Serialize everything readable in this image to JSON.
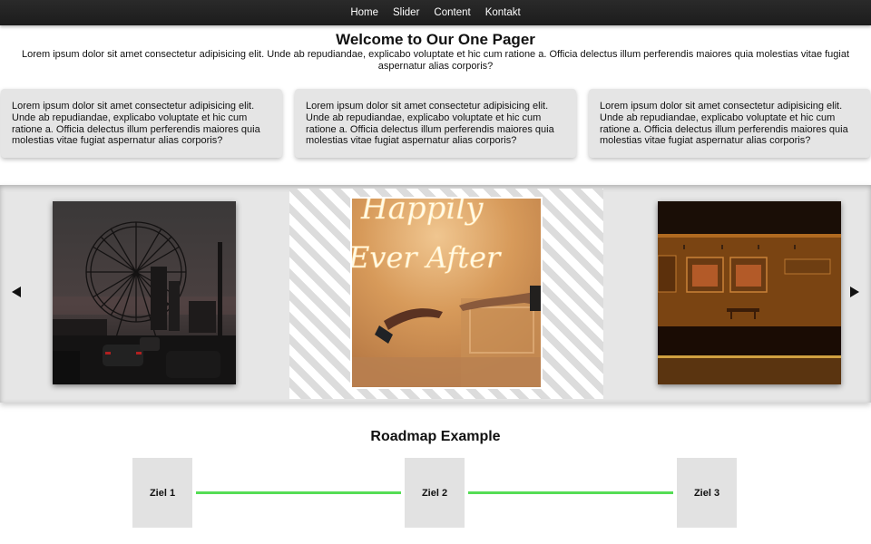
{
  "nav": {
    "items": [
      "Home",
      "Slider",
      "Content",
      "Kontakt"
    ]
  },
  "hero": {
    "title": "Welcome to Our One Pager",
    "text": "Lorem ipsum dolor sit amet consectetur adipisicing elit. Unde ab repudiandae, explicabo voluptate et hic cum ratione a. Officia delectus illum perferendis maiores quia molestias vitae fugiat aspernatur alias corporis?"
  },
  "cards": [
    {
      "text": "Lorem ipsum dolor sit amet consectetur adipisicing elit. Unde ab repudiandae, explicabo voluptate et hic cum ratione a. Officia delectus illum perferendis maiores quia molestias vitae fugiat aspernatur alias corporis?"
    },
    {
      "text": "Lorem ipsum dolor sit amet consectetur adipisicing elit. Unde ab repudiandae, explicabo voluptate et hic cum ratione a. Officia delectus illum perferendis maiores quia molestias vitae fugiat aspernatur alias corporis?"
    },
    {
      "text": "Lorem ipsum dolor sit amet consectetur adipisicing elit. Unde ab repudiandae, explicabo voluptate et hic cum ratione a. Officia delectus illum perferendis maiores quia molestias vitae fugiat aspernatur alias corporis?"
    }
  ],
  "slider": {
    "prev_icon": "triangle-left-icon",
    "next_icon": "triangle-right-icon",
    "images": [
      {
        "subject": "ferris-wheel-city-dusk"
      },
      {
        "subject": "neon-happily-ever-after-hands"
      },
      {
        "subject": "subway-station-platform"
      }
    ],
    "neon_text_line1": "Happily",
    "neon_text_line2": "Ever After"
  },
  "roadmap": {
    "title": "Roadmap Example",
    "milestones": [
      "Ziel 1",
      "Ziel 2",
      "Ziel 3"
    ],
    "line_color": "#55dd55"
  }
}
